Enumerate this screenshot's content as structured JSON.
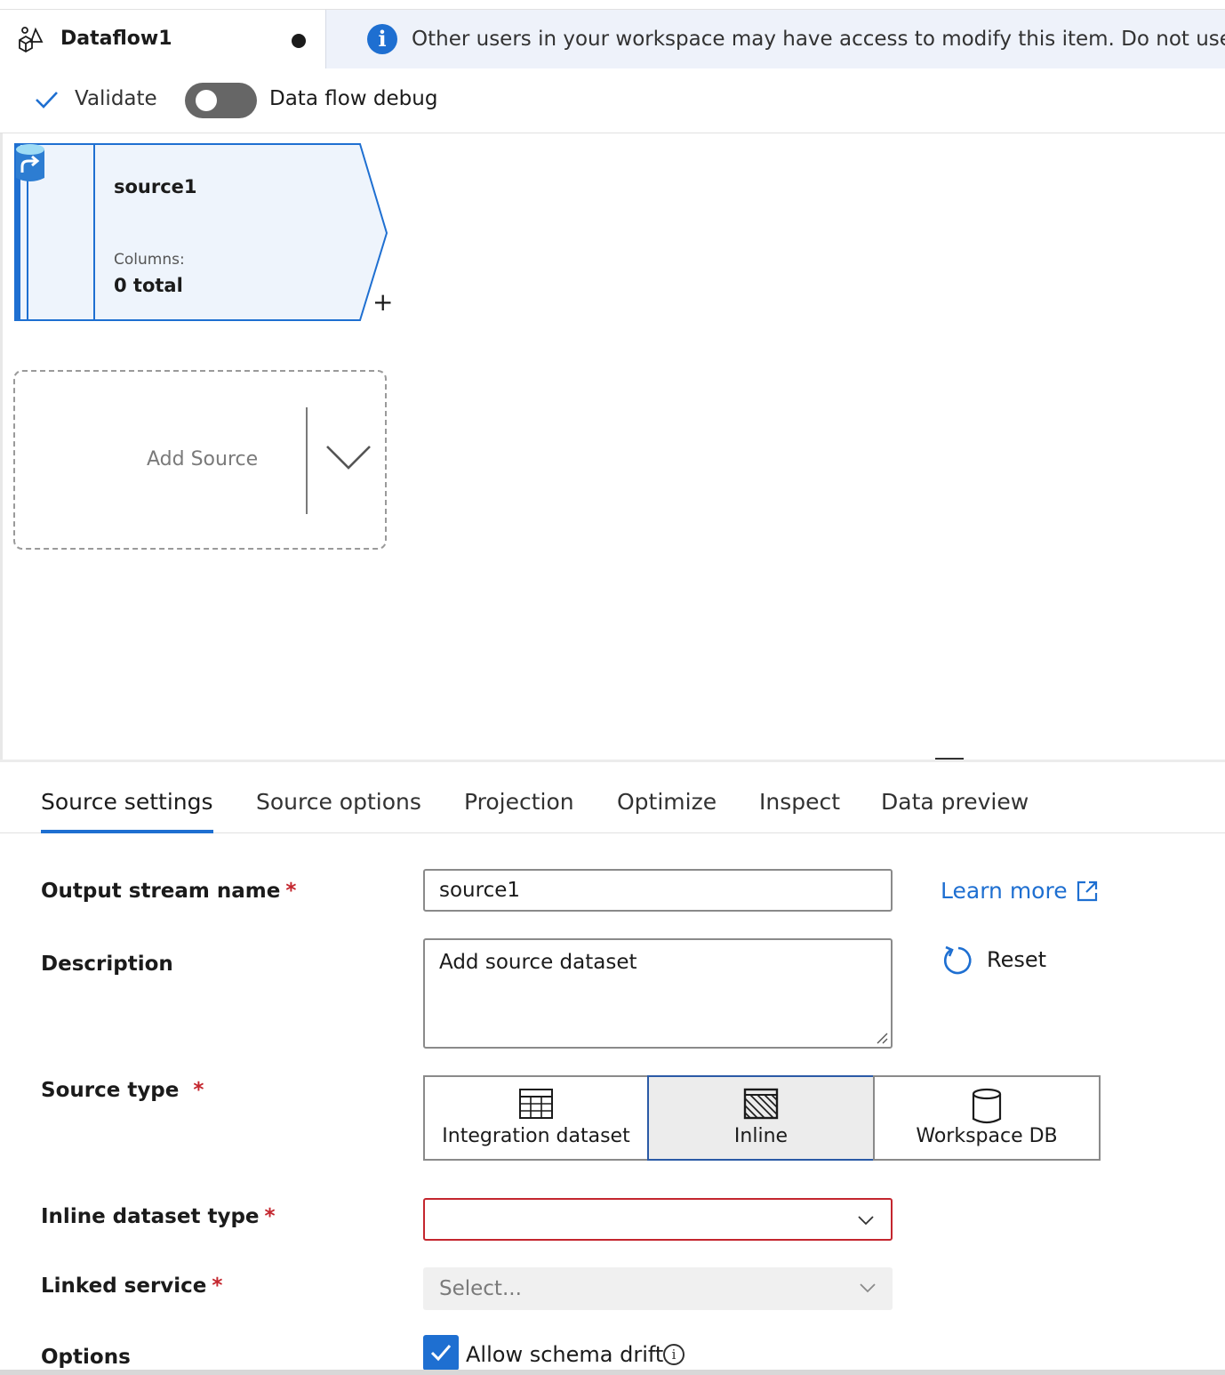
{
  "document": {
    "title": "Dataflow1",
    "unsaved_indicator": "●"
  },
  "banner": {
    "icon": "info-icon",
    "message": "Other users in your workspace may have access to modify this item. Do not use t"
  },
  "toolbar": {
    "validate_label": "Validate",
    "debug_label": "Data flow debug",
    "debug_enabled": false
  },
  "canvas": {
    "source_node": {
      "title": "source1",
      "columns_label": "Columns:",
      "columns_value": "0 total",
      "add_label": "+"
    },
    "add_source": {
      "label": "Add Source"
    }
  },
  "panel": {
    "tabs": [
      {
        "label": "Source settings",
        "active": true
      },
      {
        "label": "Source options",
        "active": false
      },
      {
        "label": "Projection",
        "active": false
      },
      {
        "label": "Optimize",
        "active": false
      },
      {
        "label": "Inspect",
        "active": false
      },
      {
        "label": "Data preview",
        "active": false
      }
    ],
    "output_stream": {
      "label": "Output stream name",
      "required": "*",
      "value": "source1"
    },
    "description": {
      "label": "Description",
      "value": "Add source dataset"
    },
    "learn_more": "Learn more",
    "reset": "Reset",
    "source_type": {
      "label": "Source type",
      "required": "*",
      "options": [
        {
          "label": "Integration dataset",
          "icon": "table-icon",
          "selected": false
        },
        {
          "label": "Inline",
          "icon": "inline-icon",
          "selected": true
        },
        {
          "label": "Workspace DB",
          "icon": "database-icon",
          "selected": false
        }
      ]
    },
    "inline_dataset_type": {
      "label": "Inline dataset type",
      "required": "*",
      "value": ""
    },
    "linked_service": {
      "label": "Linked service",
      "required": "*",
      "placeholder": "Select..."
    },
    "options": {
      "label": "Options",
      "allow_schema_drift": "Allow schema drift",
      "checked": true
    }
  },
  "colors": {
    "accent": "#1e6fd1",
    "error": "#c4262e",
    "node_fill": "#eef4fc"
  }
}
